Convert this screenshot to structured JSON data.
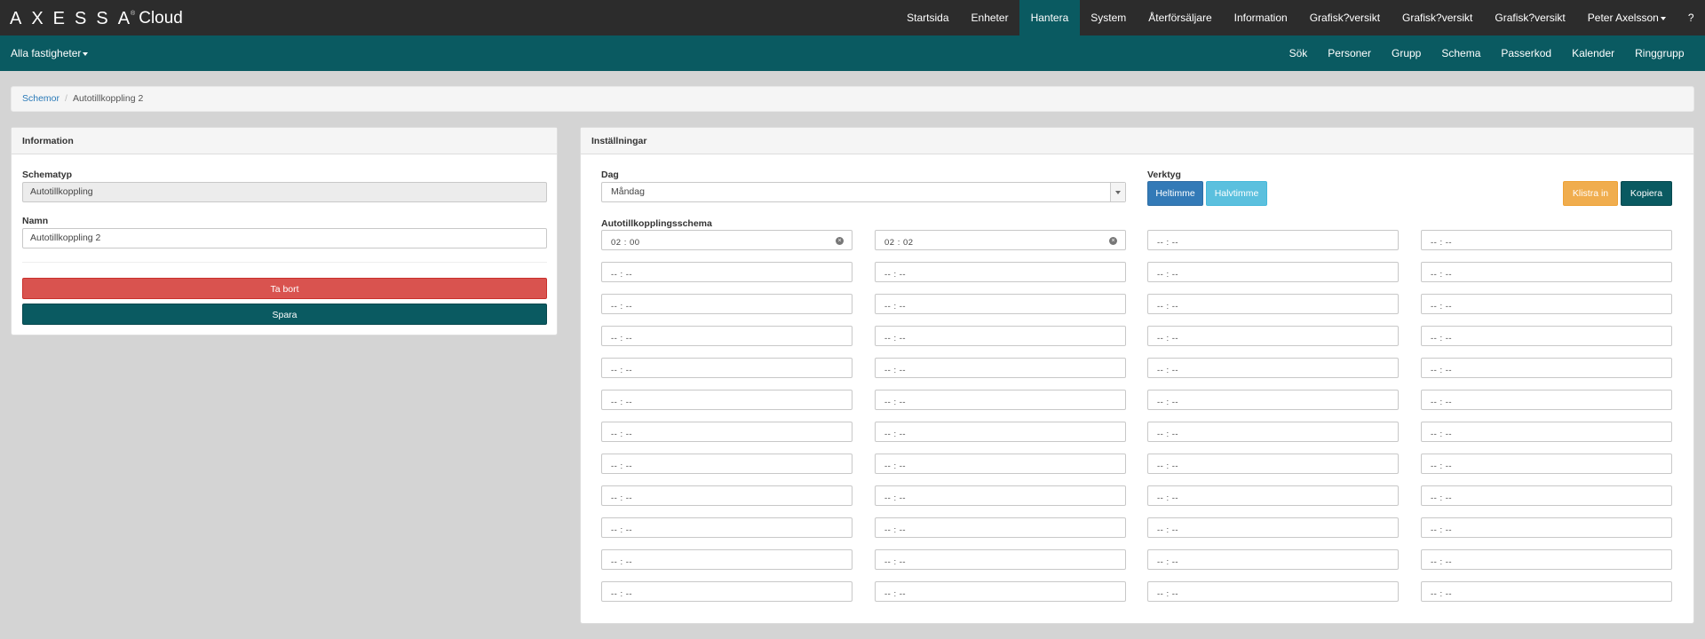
{
  "brand": {
    "wordmark": "AXESSA",
    "sup": "®",
    "cloud": "Cloud"
  },
  "topnav": [
    {
      "label": "Startsida",
      "active": false
    },
    {
      "label": "Enheter",
      "active": false
    },
    {
      "label": "Hantera",
      "active": true
    },
    {
      "label": "System",
      "active": false
    },
    {
      "label": "Återförsäljare",
      "active": false
    },
    {
      "label": "Information",
      "active": false
    },
    {
      "label": "Grafisk?versikt",
      "active": false
    },
    {
      "label": "Grafisk?versikt",
      "active": false
    },
    {
      "label": "Grafisk?versikt",
      "active": false
    },
    {
      "label": "Peter Axelsson",
      "active": false,
      "dropdown": true
    },
    {
      "label": "?",
      "active": false
    }
  ],
  "subbar": {
    "left_label": "Alla fastigheter",
    "items": [
      "Sök",
      "Personer",
      "Grupp",
      "Schema",
      "Passerkod",
      "Kalender",
      "Ringgrupp"
    ]
  },
  "breadcrumb": {
    "link": "Schemor",
    "sep": "/",
    "current": "Autotillkoppling 2"
  },
  "info_panel": {
    "title": "Information",
    "type_label": "Schematyp",
    "type_value": "Autotillkoppling",
    "name_label": "Namn",
    "name_value": "Autotillkoppling 2",
    "delete_label": "Ta bort",
    "save_label": "Spara"
  },
  "settings_panel": {
    "title": "Inställningar",
    "day_label": "Dag",
    "day_value": "Måndag",
    "tools_label": "Verktyg",
    "full_hour_label": "Heltimme",
    "half_hour_label": "Halvtimme",
    "paste_label": "Klistra in",
    "copy_label": "Kopiera",
    "schedule_label": "Autotillkopplingsschema",
    "empty_time": "-- : --",
    "times": [
      [
        "02 : 00",
        "02 : 02",
        "",
        ""
      ],
      [
        "",
        "",
        "",
        ""
      ],
      [
        "",
        "",
        "",
        ""
      ],
      [
        "",
        "",
        "",
        ""
      ],
      [
        "",
        "",
        "",
        ""
      ],
      [
        "",
        "",
        "",
        ""
      ],
      [
        "",
        "",
        "",
        ""
      ],
      [
        "",
        "",
        "",
        ""
      ],
      [
        "",
        "",
        "",
        ""
      ],
      [
        "",
        "",
        "",
        ""
      ],
      [
        "",
        "",
        "",
        ""
      ],
      [
        "",
        "",
        "",
        ""
      ]
    ]
  },
  "colors": {
    "topbar": "#2c2c2c",
    "teal": "#0a5a61",
    "danger": "#d9534f",
    "primary": "#337ab7",
    "info": "#5bc0de",
    "warning": "#f0ad4e"
  }
}
